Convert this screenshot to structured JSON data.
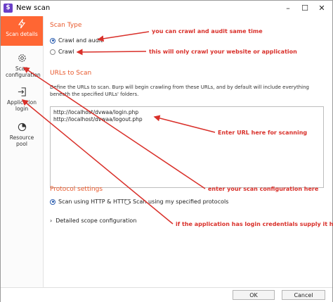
{
  "window": {
    "title": "New scan",
    "app_icon_glyph": "$"
  },
  "sidebar": {
    "items": [
      {
        "label": "Scan details",
        "icon": "bolt-icon",
        "active": true
      },
      {
        "label": "Scan configuration",
        "icon": "gear-icon",
        "active": false
      },
      {
        "label": "Application login",
        "icon": "login-icon",
        "active": false
      },
      {
        "label": "Resource pool",
        "icon": "pie-icon",
        "active": false
      }
    ]
  },
  "scan_type": {
    "title": "Scan Type",
    "options": [
      {
        "label": "Crawl and audit",
        "checked": true
      },
      {
        "label": "Crawl",
        "checked": false
      }
    ]
  },
  "urls": {
    "title": "URLs to Scan",
    "description": "Define the URLs to scan. Burp will begin crawling from these URLs, and by default will include everything beneath the specified URLs' folders.",
    "entries": [
      "http://localhost/dvwaa/login.php",
      "http://localhost/dvwaa/logout.php"
    ]
  },
  "protocol": {
    "title": "Protocol settings",
    "options": [
      {
        "label": "Scan using HTTP & HTTPS",
        "checked": true
      },
      {
        "label": "Scan using my specified protocols",
        "checked": false
      }
    ]
  },
  "detailed_scope": {
    "label": "Detailed scope configuration"
  },
  "annotations": {
    "crawl_audit": "you can crawl and audit same time",
    "crawl_only": "this will only crawl your website or application",
    "enter_url": "Enter URL here for scanning",
    "enter_config": "enter your scan configuration here",
    "login": "if the application has login credentials supply it here"
  },
  "buttons": {
    "ok": "OK",
    "cancel": "Cancel"
  },
  "colors": {
    "accent": "#ff6633",
    "section_title": "#e8582b",
    "annotation": "#d9302a",
    "radio_checked": "#2d5fb0"
  }
}
